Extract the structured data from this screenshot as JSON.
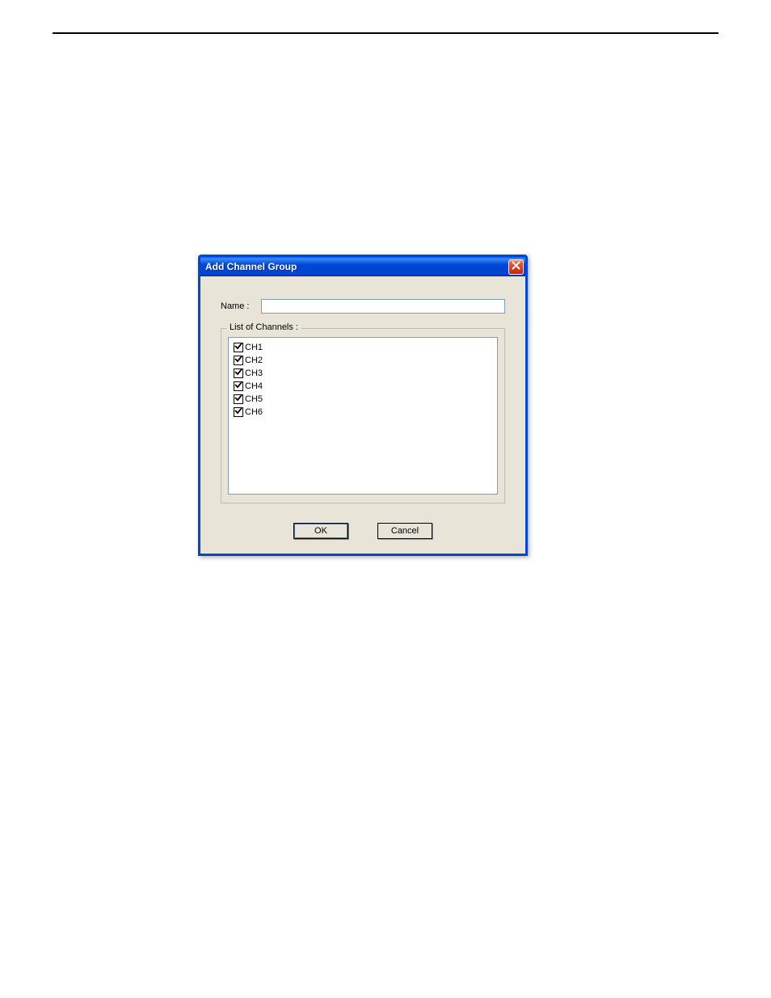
{
  "dialog": {
    "title": "Add Channel Group",
    "name_label": "Name :",
    "name_value": "",
    "list_label": "List of Channels :",
    "channels": [
      {
        "label": "CH1",
        "checked": true
      },
      {
        "label": "CH2",
        "checked": true
      },
      {
        "label": "CH3",
        "checked": true
      },
      {
        "label": "CH4",
        "checked": true
      },
      {
        "label": "CH5",
        "checked": true
      },
      {
        "label": "CH6",
        "checked": true
      }
    ],
    "ok_label": "OK",
    "cancel_label": "Cancel"
  }
}
